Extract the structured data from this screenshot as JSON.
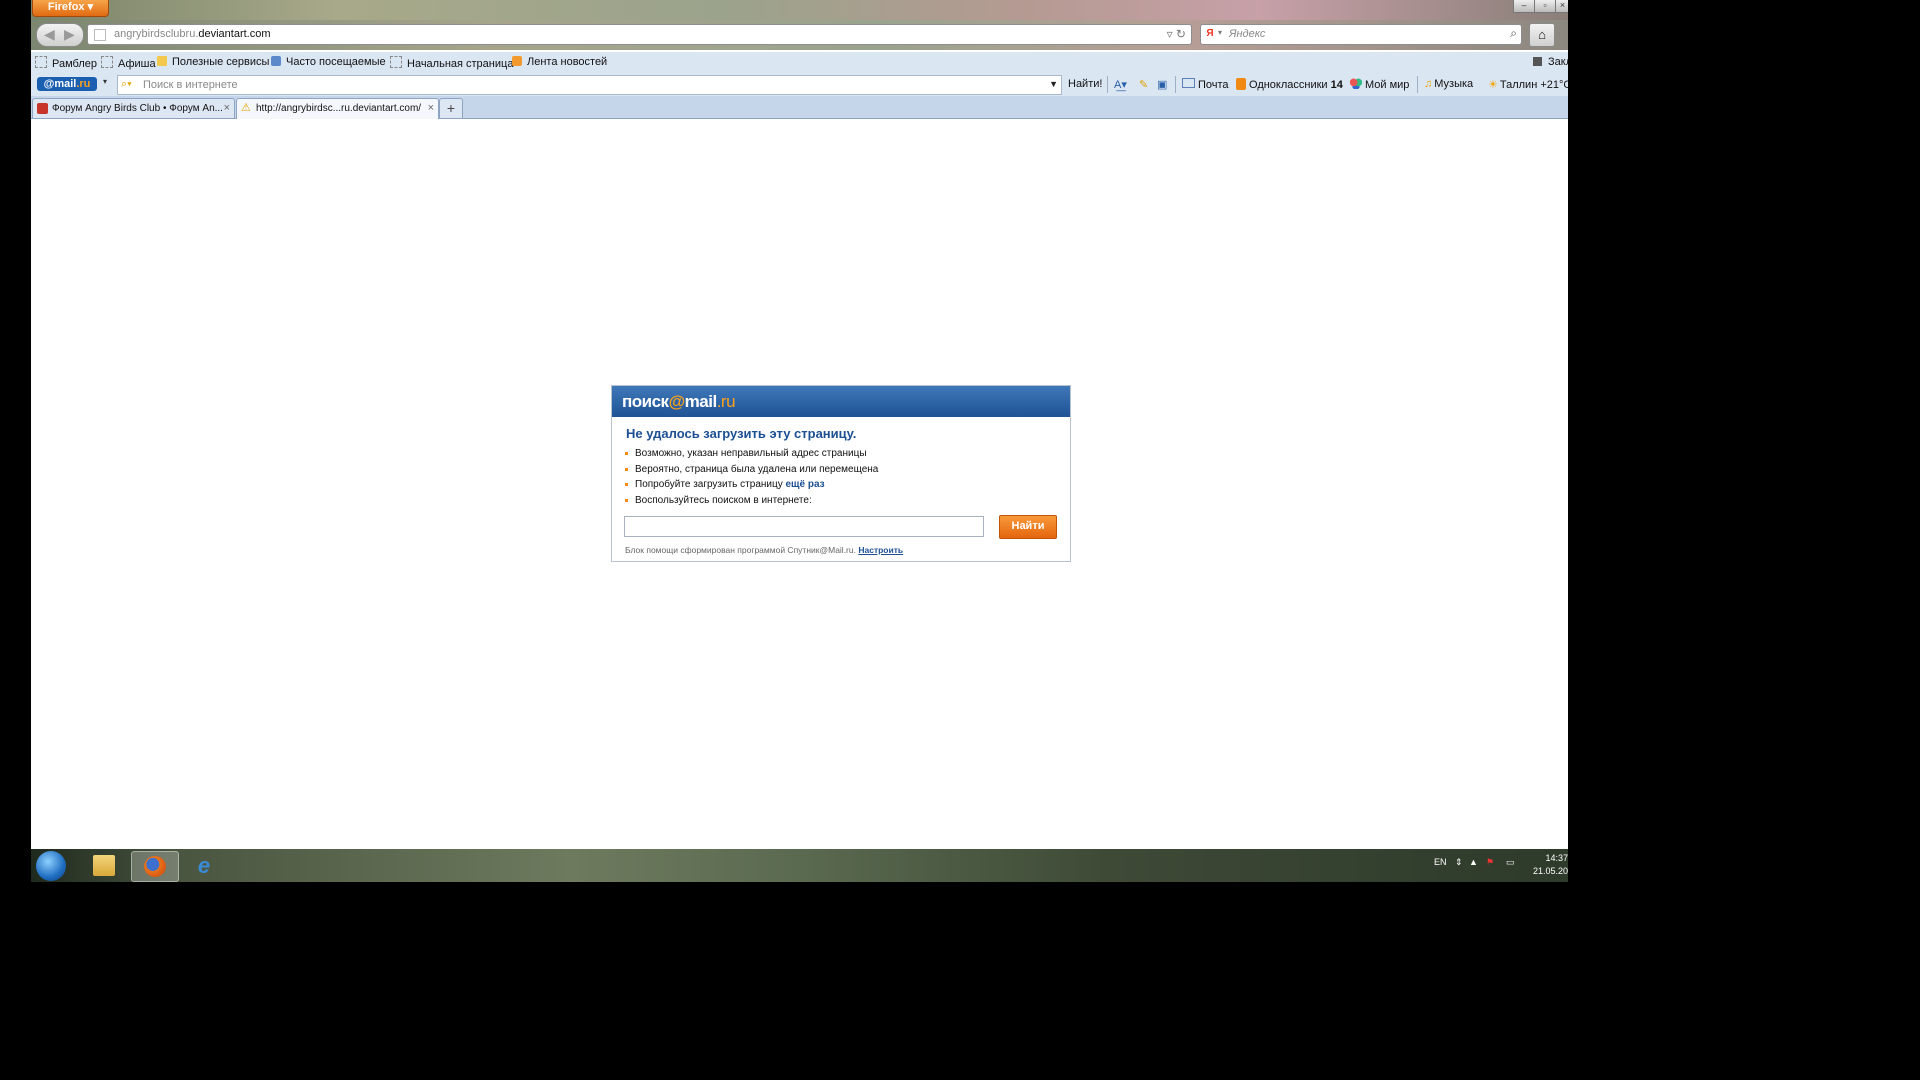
{
  "browser": {
    "menu_button": "Firefox",
    "url_prefix": "angrybirdsclubru.",
    "url_domain": "deviantart.com",
    "search_engine_icon": "Я",
    "search_placeholder": "Яндекс"
  },
  "bookmarks": [
    {
      "label": "Рамблер",
      "icon": "page-icon"
    },
    {
      "label": "Афиша",
      "icon": "page-icon"
    },
    {
      "label": "Полезные сервисы",
      "icon": "folder-icon"
    },
    {
      "label": "Часто посещаемые",
      "icon": "star-icon"
    },
    {
      "label": "Начальная страница",
      "icon": "page-icon"
    },
    {
      "label": "Лента новостей",
      "icon": "rss-icon"
    }
  ],
  "bookmarks_right": "Закл",
  "mailru_toolbar": {
    "logo_text": "@mail",
    "logo_suffix": ".ru",
    "search_placeholder": "Поиск в интернете",
    "search_button": "Найти!",
    "mail": "Почта",
    "odnoklassniki": "Одноклассники",
    "odnoklassniki_count": "14",
    "my_world": "Мой мир",
    "music": "Музыка",
    "weather": "Таллин +21°С"
  },
  "tabs": [
    {
      "title": "Форум Angry Birds Club • Форум An...",
      "active": false
    },
    {
      "title": "http://angrybirdsc...ru.deviantart.com/",
      "active": true
    }
  ],
  "error_page": {
    "logo": {
      "word": "поиск",
      "at": "@",
      "mail": "mail",
      "ru": ".ru"
    },
    "title": "Не удалось загрузить эту страницу.",
    "reasons": [
      "Возможно, указан неправильный адрес страницы",
      "Вероятно, страница была удалена или перемещена",
      "Попробуйте загрузить страницу",
      "Воспользуйтесь поиском в интернете:"
    ],
    "retry_link": "ещё раз",
    "search_button": "Найти",
    "note": "Блок помощи сформирован программой Спутник@Mail.ru.",
    "settings_link": "Настроить"
  },
  "taskbar": {
    "language": "EN",
    "time": "14:37",
    "date": "21.05.20"
  },
  "colors": {
    "accent_orange": "#f08a14",
    "mail_blue": "#1c4f94"
  }
}
